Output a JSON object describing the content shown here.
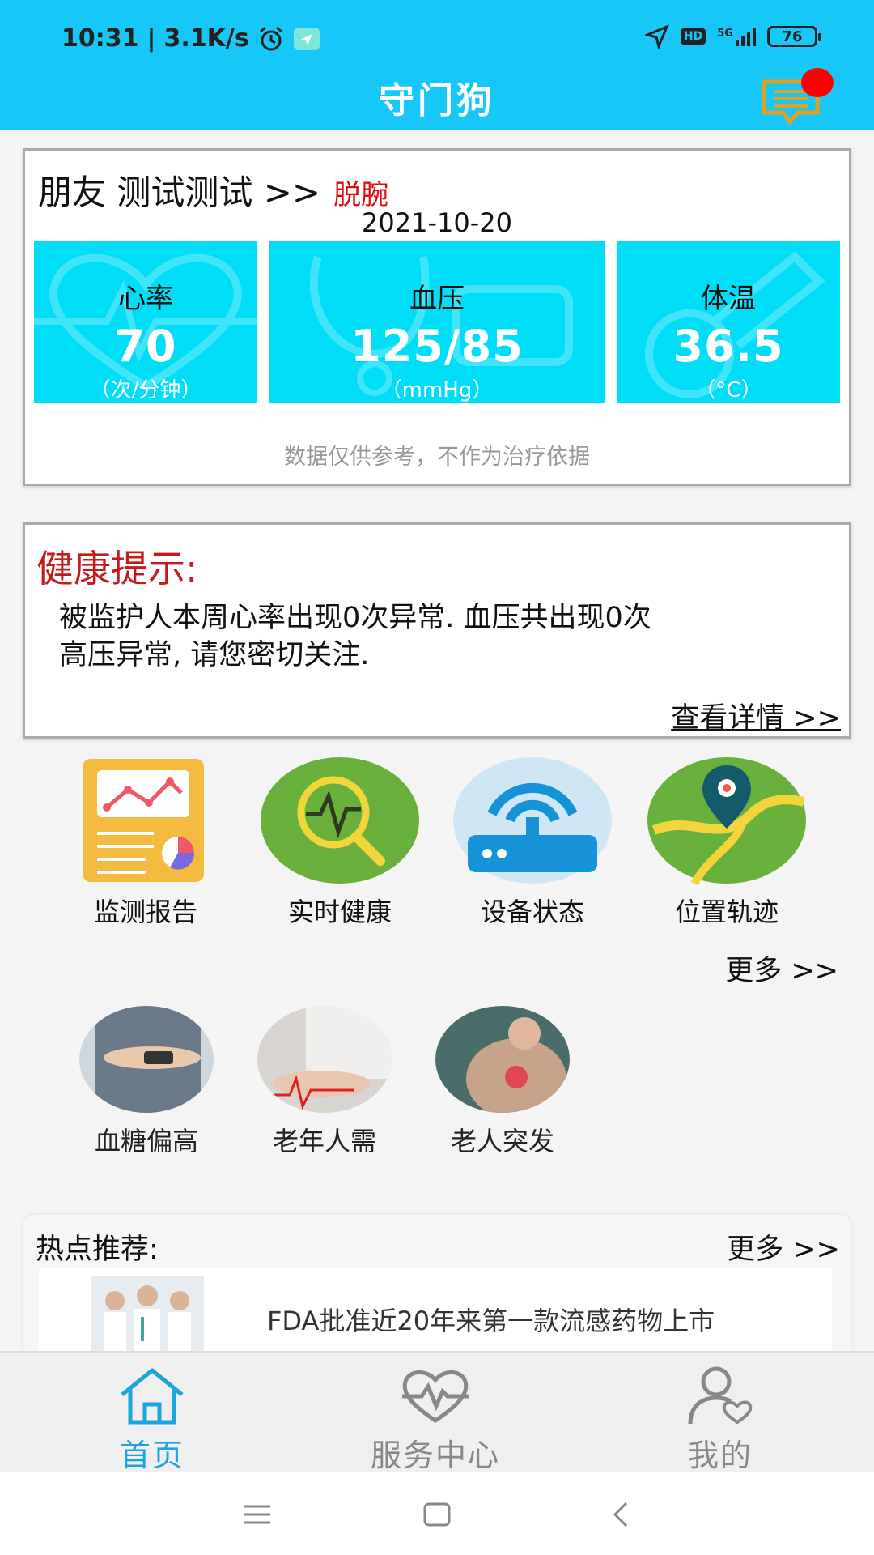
{
  "status_bar": {
    "time": "10:31",
    "separator": "|",
    "speed": "3.1K/s",
    "hd": "HD",
    "network": "5G",
    "battery": "76"
  },
  "header": {
    "title": "守门狗"
  },
  "friend_card": {
    "name_line": "朋友 测试测试 >>",
    "status": "脱腕",
    "date": "2021-10-20",
    "metrics": [
      {
        "label": "心率",
        "value": "70",
        "unit": "（次/分钟）"
      },
      {
        "label": "血压",
        "value": "125/85",
        "unit": "（mmHg）"
      },
      {
        "label": "体温",
        "value": "36.5",
        "unit": "（°C）"
      }
    ],
    "disclaimer": "数据仅供参考，不作为治疗依据"
  },
  "health_tips": {
    "title": "健康提示:",
    "line1": "被监护人本周心率出现0次异常. 血压共出现0次",
    "line2": "高压异常, 请您密切关注.",
    "link": "查看详情 >>"
  },
  "quick_actions": [
    {
      "label": "监测报告",
      "icon": "report-icon"
    },
    {
      "label": "实时健康",
      "icon": "pulse-magnifier-icon"
    },
    {
      "label": "设备状态",
      "icon": "router-icon"
    },
    {
      "label": "位置轨迹",
      "icon": "map-pin-icon"
    }
  ],
  "more_label": "更多 >>",
  "articles": [
    {
      "label": "血糖偏高"
    },
    {
      "label": "老年人需"
    },
    {
      "label": "老人突发"
    }
  ],
  "hot": {
    "title": "热点推荐:",
    "more": "更多 >>",
    "news": [
      {
        "title": "FDA批准近20年来第一款流感药物上市"
      }
    ]
  },
  "tabs": [
    {
      "label": "首页",
      "icon": "home-icon",
      "active": true
    },
    {
      "label": "服务中心",
      "icon": "heart-pulse-icon",
      "active": false
    },
    {
      "label": "我的",
      "icon": "user-heart-icon",
      "active": false
    }
  ],
  "colors": {
    "primary": "#16c7f7",
    "metric_tile": "#00ddf7",
    "alert_red": "#d81010",
    "active_tab": "#1aa5dd",
    "inactive_tab": "#888888"
  }
}
